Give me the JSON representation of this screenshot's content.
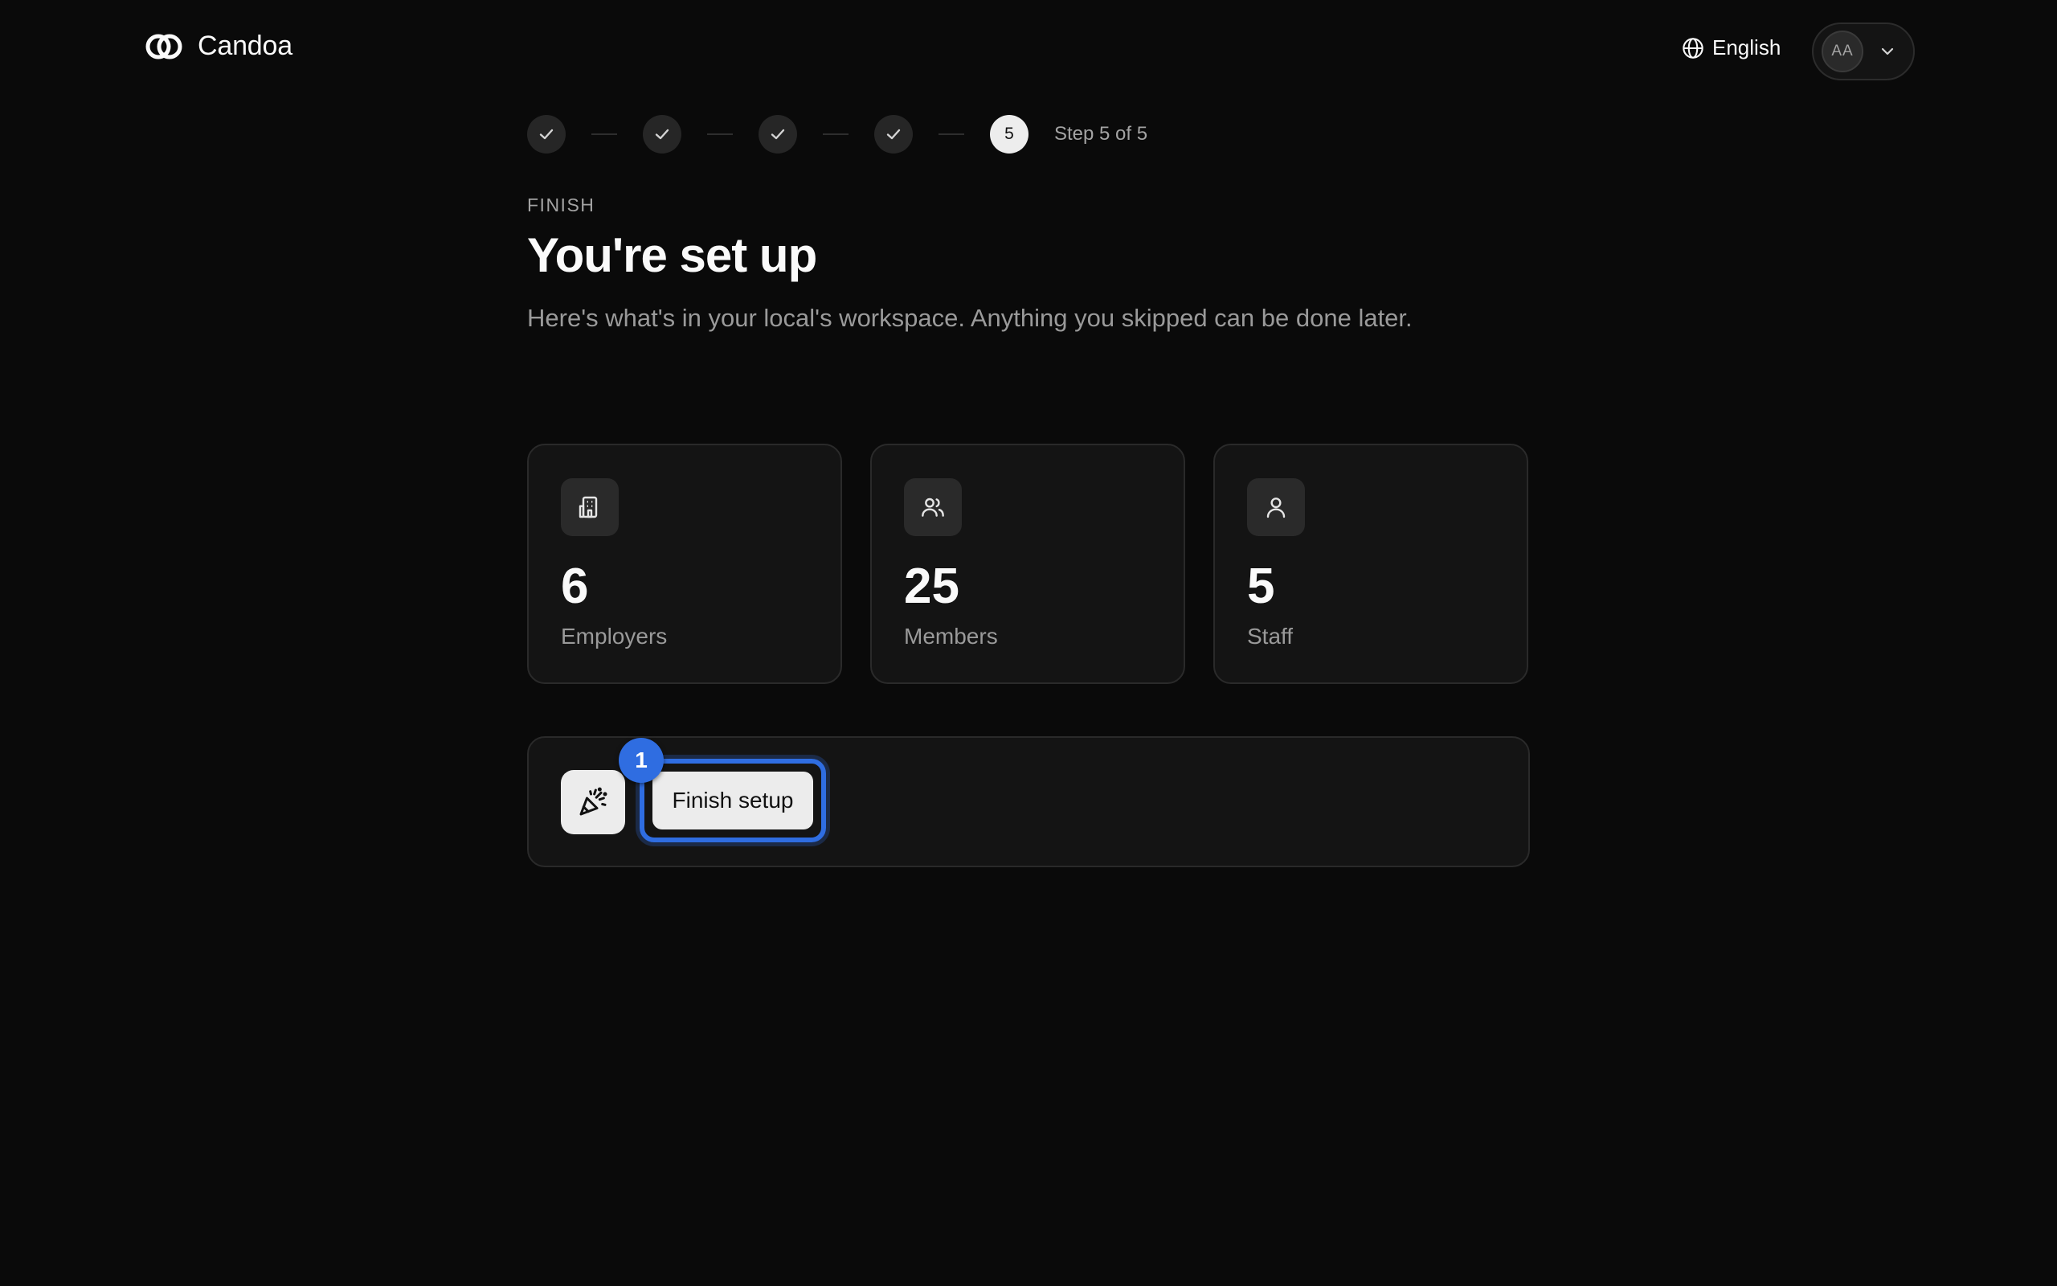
{
  "brand": {
    "name": "Candoa",
    "icon": "candoa-logo-icon"
  },
  "header": {
    "language": "English",
    "language_icon": "globe-icon",
    "user_initials": "AA",
    "menu_icon": "chevron-down-icon"
  },
  "stepper": {
    "completed_steps": 4,
    "current_step": "5",
    "label": "Step 5 of 5"
  },
  "heading": {
    "eyebrow": "FINISH",
    "title": "You're set up",
    "subtitle": "Here's what's in your local's workspace. Anything you skipped can be done later."
  },
  "stats": [
    {
      "icon": "building-icon",
      "value": "6",
      "label": "Employers"
    },
    {
      "icon": "users-icon",
      "value": "25",
      "label": "Members"
    },
    {
      "icon": "user-icon",
      "value": "5",
      "label": "Staff"
    }
  ],
  "finish": {
    "icon": "party-popper-icon",
    "button_label": "Finish setup",
    "marker": "1"
  },
  "colors": {
    "background": "#0a0a0a",
    "card": "#141414",
    "accent": "#2f6de1"
  }
}
